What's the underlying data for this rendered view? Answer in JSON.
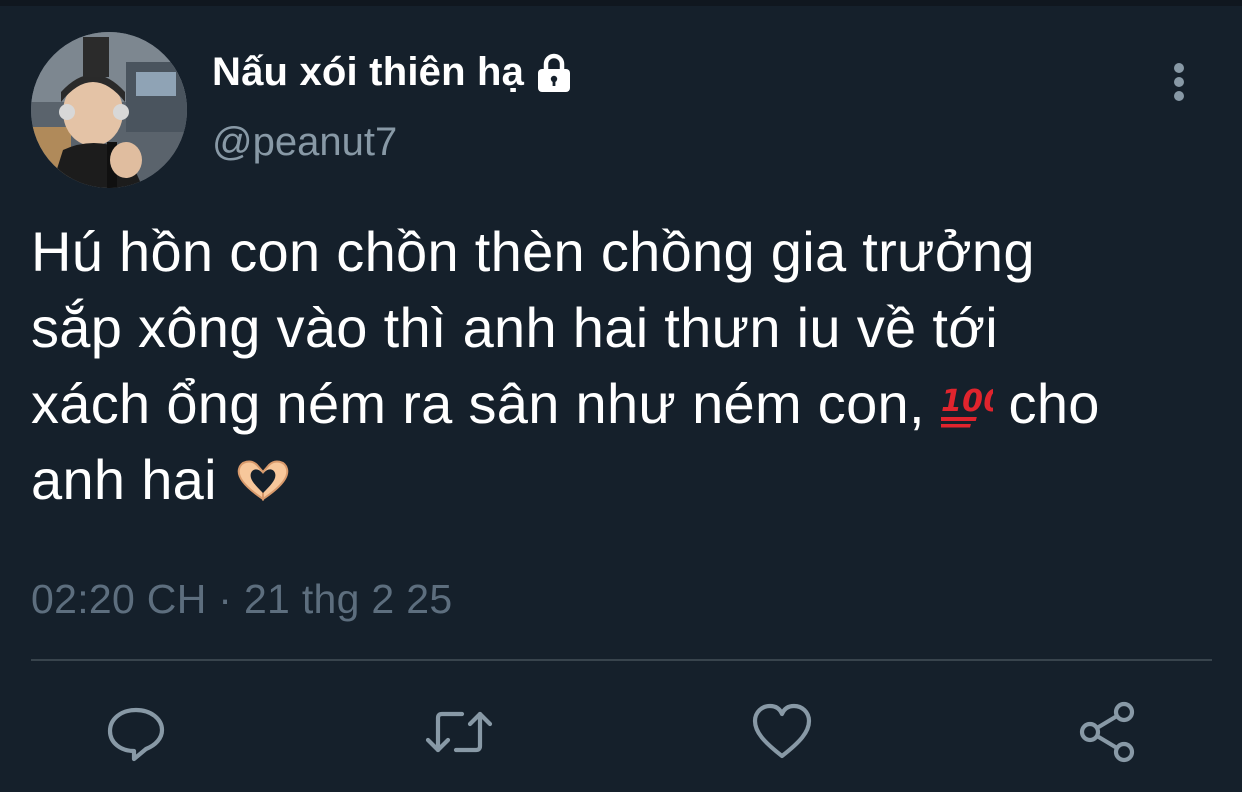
{
  "theme": {
    "background": "#15202b",
    "text_primary": "#ffffff",
    "text_secondary": "#8899a6",
    "icon_color": "#8899a6",
    "divider": "#38444d"
  },
  "author": {
    "display_name": "Nấu xói thiên hạ",
    "handle": "@peanut7",
    "protected_icon": "lock-icon",
    "avatar_icon": "user-avatar"
  },
  "menu": {
    "icon": "more-vertical-icon"
  },
  "tweet": {
    "lines": [
      "Hú hồn con chồn thèn chồng gia trưởng",
      "sắp xông vào thì anh hai thưn iu về tới",
      "xách ổng ném ra sân như ném con, ",
      "anh hai "
    ],
    "line3_tail": " cho",
    "emoji_hundred": "💯",
    "emoji_heart_hands": "🫶"
  },
  "timestamp": "02:20 CH · 21 thg 2 25",
  "actions": [
    {
      "name": "reply",
      "icon": "comment-icon"
    },
    {
      "name": "retweet",
      "icon": "retweet-icon"
    },
    {
      "name": "like",
      "icon": "heart-icon"
    },
    {
      "name": "share",
      "icon": "share-icon"
    }
  ]
}
